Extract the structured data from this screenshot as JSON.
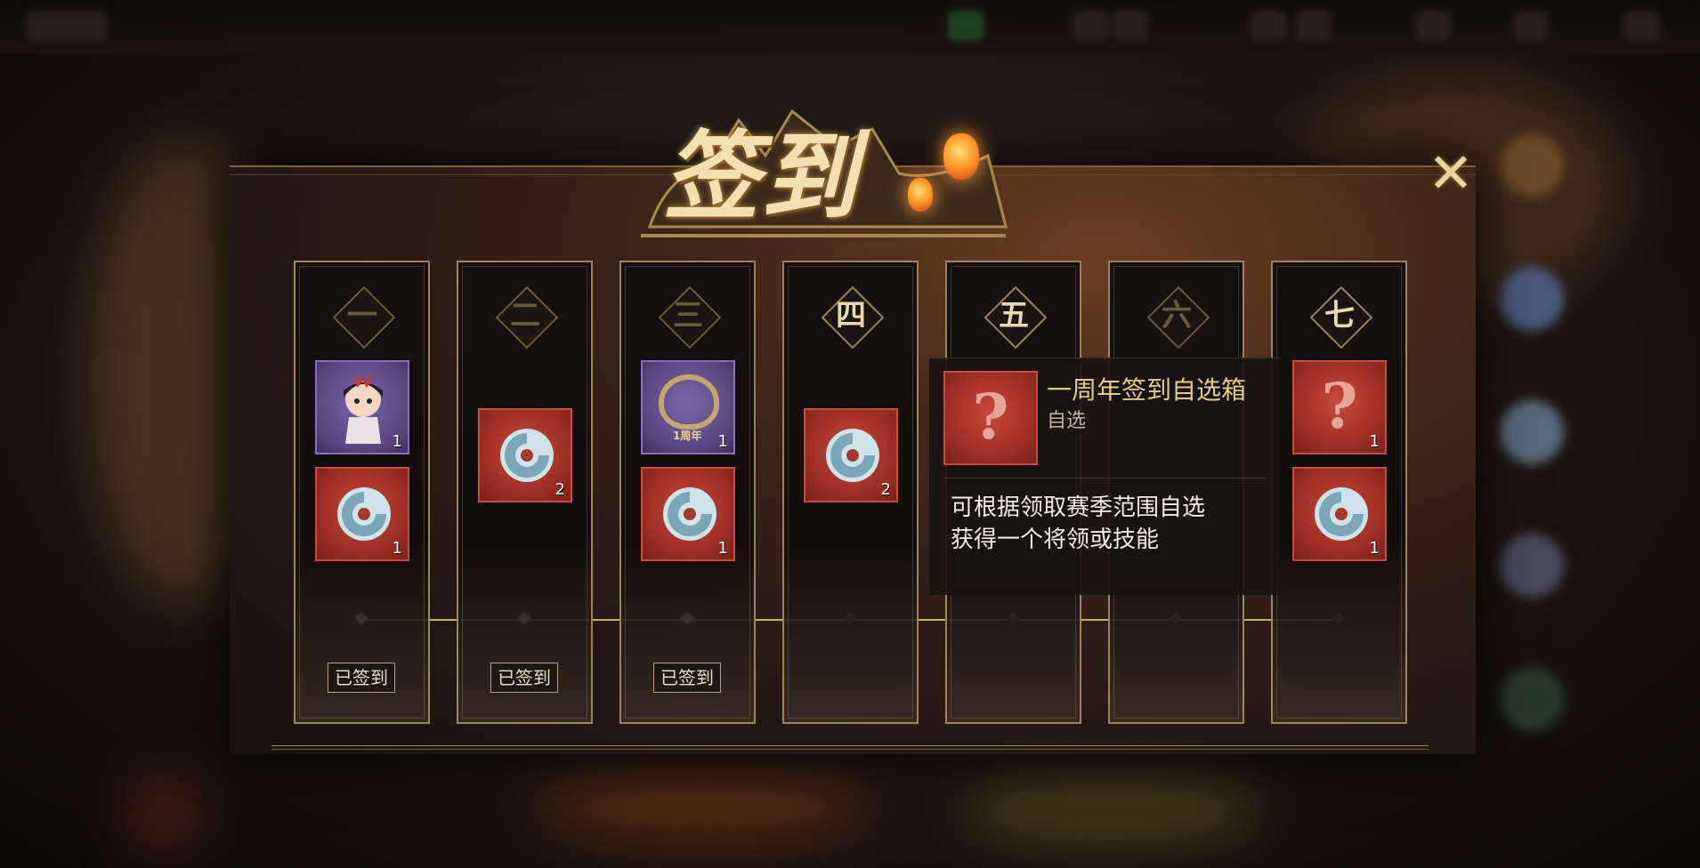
{
  "title": "签到",
  "close_label": "✕",
  "days": [
    {
      "label": "一",
      "status": "已签到",
      "rewards": [
        {
          "kind": "hero-avatar",
          "count": "1"
        },
        {
          "kind": "jade-orb",
          "count": "1"
        }
      ]
    },
    {
      "label": "二",
      "status": "已签到",
      "rewards": [
        {
          "kind": "jade-orb",
          "count": "2"
        }
      ]
    },
    {
      "label": "三",
      "status": "已签到",
      "rewards": [
        {
          "kind": "anniversary-frame",
          "count": "1",
          "caption": "1周年"
        },
        {
          "kind": "jade-orb",
          "count": "1"
        }
      ]
    },
    {
      "label": "四",
      "status": "",
      "rewards": [
        {
          "kind": "jade-orb",
          "count": "2"
        }
      ]
    },
    {
      "label": "五",
      "status": "",
      "rewards": []
    },
    {
      "label": "六",
      "status": "",
      "rewards": []
    },
    {
      "label": "七",
      "status": "",
      "rewards": [
        {
          "kind": "mystery-box",
          "count": "1"
        },
        {
          "kind": "jade-orb",
          "count": "1"
        }
      ]
    }
  ],
  "progress": {
    "claimed_days": 3,
    "total_days": 7
  },
  "tooltip": {
    "title": "一周年签到自选箱",
    "subtitle": "自选",
    "description_line1": "可根据领取赛季范围自选",
    "description_line2": "获得一个将领或技能"
  },
  "colors": {
    "gold": "#e9d39e",
    "reward_red": "#b53a2e",
    "reward_purple": "#6a5592",
    "track": "#c9b06a"
  }
}
